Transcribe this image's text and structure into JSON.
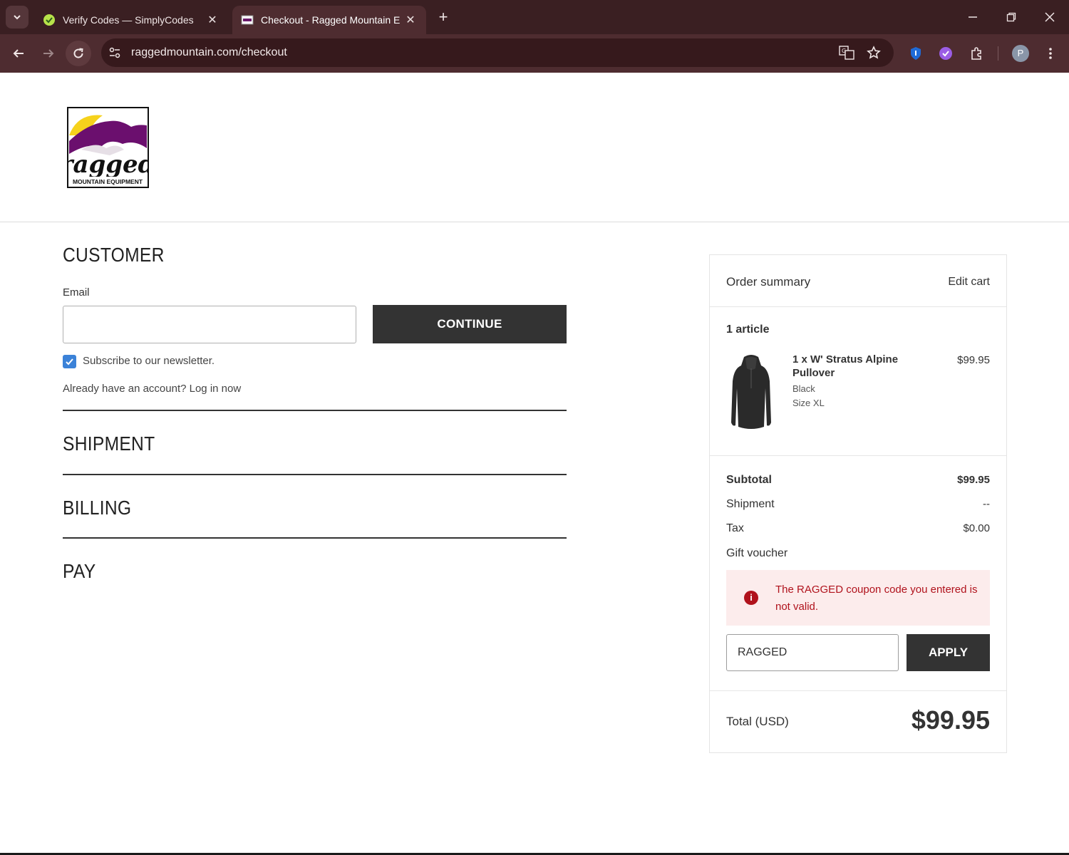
{
  "browser": {
    "tabs": [
      {
        "title": "Verify Codes — SimplyCodes",
        "active": false
      },
      {
        "title": "Checkout - Ragged Mountain E",
        "active": true
      }
    ],
    "url": "raggedmountain.com/checkout",
    "profile_initial": "P"
  },
  "logo": {
    "word": "ragged",
    "tagline": "MOUNTAIN EQUIPMENT"
  },
  "checkout": {
    "customer_title": "CUSTOMER",
    "email_label": "Email",
    "email_value": "",
    "continue_label": "CONTINUE",
    "newsletter_label": "Subscribe to our newsletter.",
    "newsletter_checked": true,
    "login_prompt": "Already have an account? Log in now",
    "shipment_title": "SHIPMENT",
    "billing_title": "BILLING",
    "pay_title": "PAY"
  },
  "summary": {
    "title": "Order summary",
    "edit_cart": "Edit cart",
    "article_count": "1 article",
    "item": {
      "name": "1 x W' Stratus Alpine Pullover",
      "color": "Black",
      "size": "Size XL",
      "price": "$99.95"
    },
    "subtotal_label": "Subtotal",
    "subtotal_value": "$99.95",
    "shipment_label": "Shipment",
    "shipment_value": "--",
    "tax_label": "Tax",
    "tax_value": "$0.00",
    "gift_label": "Gift voucher",
    "error_message": "The RAGGED coupon code you entered is not valid.",
    "coupon_value": "RAGGED",
    "apply_label": "APPLY",
    "total_label": "Total (USD)",
    "total_value": "$99.95"
  },
  "colors": {
    "chrome_dark": "#3a1f22",
    "chrome_toolbar": "#4e2c30",
    "button_dark": "#333333",
    "error_red": "#b0121c",
    "error_bg": "#fcecec",
    "checkbox_blue": "#3b82d8"
  }
}
